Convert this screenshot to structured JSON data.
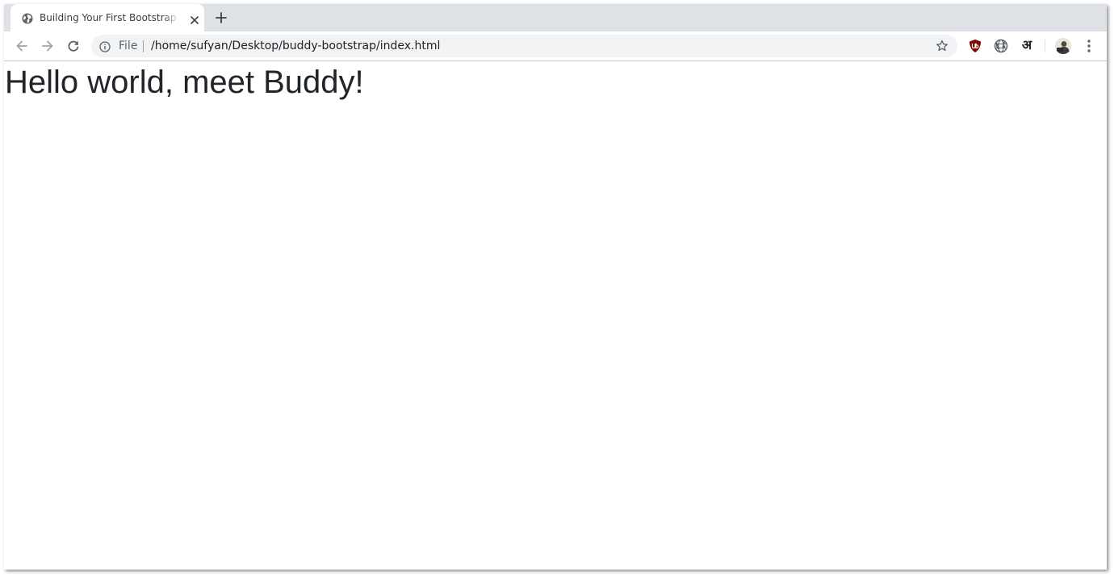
{
  "browser": {
    "tab": {
      "title": "Building Your First Bootstrap Template",
      "favicon": "globe-icon"
    },
    "toolbar": {
      "back_icon": "arrow-left-icon",
      "forward_icon": "arrow-right-icon",
      "reload_icon": "reload-icon",
      "omnibox": {
        "scheme_label": "File",
        "url": "/home/sufyan/Desktop/buddy-bootstrap/index.html"
      },
      "extensions": [
        {
          "name": "ublock-origin-icon",
          "color": "#800000"
        },
        {
          "name": "globe-extension-icon",
          "color": "#5f6368"
        },
        {
          "name": "hindi-input-icon",
          "label": "अ"
        }
      ],
      "menu_icon": "more-vert-icon"
    }
  },
  "page": {
    "heading": "Hello world, meet Buddy!",
    "text_color": "#212529"
  },
  "colors": {
    "tabstrip": "#dee1e6",
    "omnibox": "#f1f3f4",
    "icon": "#5f6368"
  }
}
